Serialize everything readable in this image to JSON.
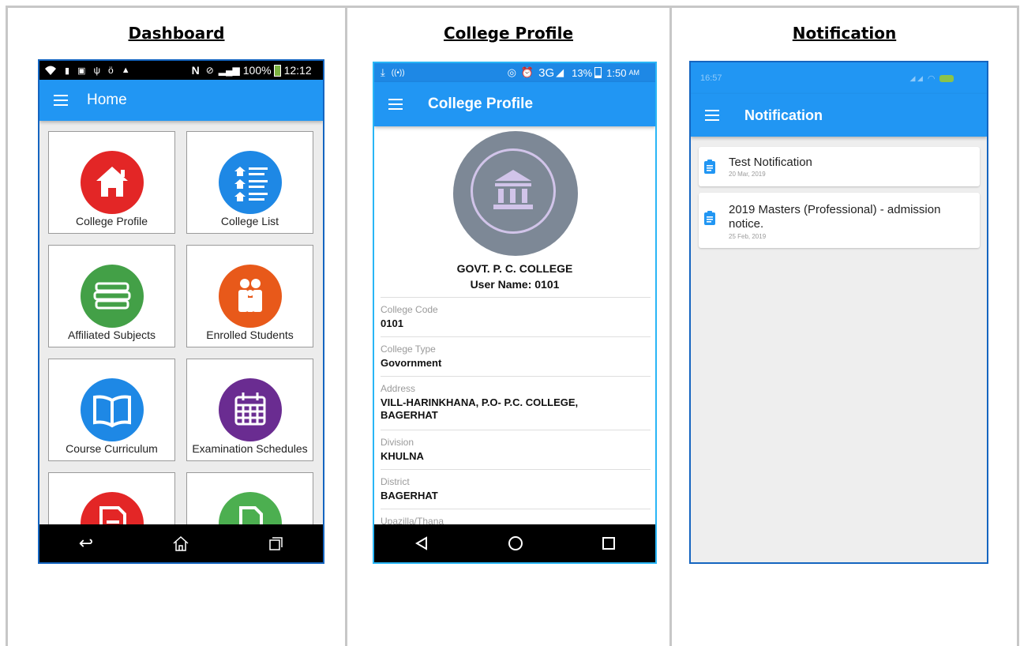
{
  "panels": {
    "dashboard": {
      "title": "Dashboard"
    },
    "college_profile": {
      "title": "College Profile"
    },
    "notification": {
      "title": "Notification"
    }
  },
  "dashboard": {
    "status": {
      "battery": "100%",
      "time": "12:12"
    },
    "appbar_title": "Home",
    "tiles": [
      {
        "label": "College Profile",
        "color": "#e32626",
        "icon": "home-icon"
      },
      {
        "label": "College List",
        "color": "#1e88e5",
        "icon": "list-icon"
      },
      {
        "label": "Affiliated Subjects",
        "color": "#43a047",
        "icon": "books-icon"
      },
      {
        "label": "Enrolled Students",
        "color": "#e8591a",
        "icon": "students-icon"
      },
      {
        "label": "Course Curriculum",
        "color": "#1e88e5",
        "icon": "open-book-icon"
      },
      {
        "label": "Examination Schedules",
        "color": "#6a2c91",
        "icon": "calendar-icon"
      },
      {
        "label": "",
        "color": "#e32626",
        "icon": "document-icon"
      },
      {
        "label": "",
        "color": "#4caf50",
        "icon": "file-icon"
      }
    ]
  },
  "college_profile": {
    "status": {
      "network": "3G",
      "battery": "13%",
      "time": "1:50",
      "ampm": "AM"
    },
    "appbar_title": "College Profile",
    "college_name": "GOVT. P. C. COLLEGE",
    "user_name": "User Name: 0101",
    "fields": [
      {
        "label": "College Code",
        "value": "0101"
      },
      {
        "label": "College Type",
        "value": "Govornment"
      },
      {
        "label": "Address",
        "value": "VILL-HARINKHANA, P.O- P.C. COLLEGE, BAGERHAT"
      },
      {
        "label": "Division",
        "value": "KHULNA"
      },
      {
        "label": "District",
        "value": "BAGERHAT"
      },
      {
        "label": "Upazilla/Thana",
        "value": ""
      }
    ]
  },
  "notification": {
    "status": {
      "time": "16:57"
    },
    "appbar_title": "Notification",
    "items": [
      {
        "title": "Test Notification",
        "date": "20 Mar, 2019"
      },
      {
        "title": "2019 Masters (Professional) - admission notice.",
        "date": "25 Feb, 2019"
      }
    ]
  },
  "colors": {
    "appbar_blue": "#2196f3",
    "panel_border": "#1565c0"
  }
}
